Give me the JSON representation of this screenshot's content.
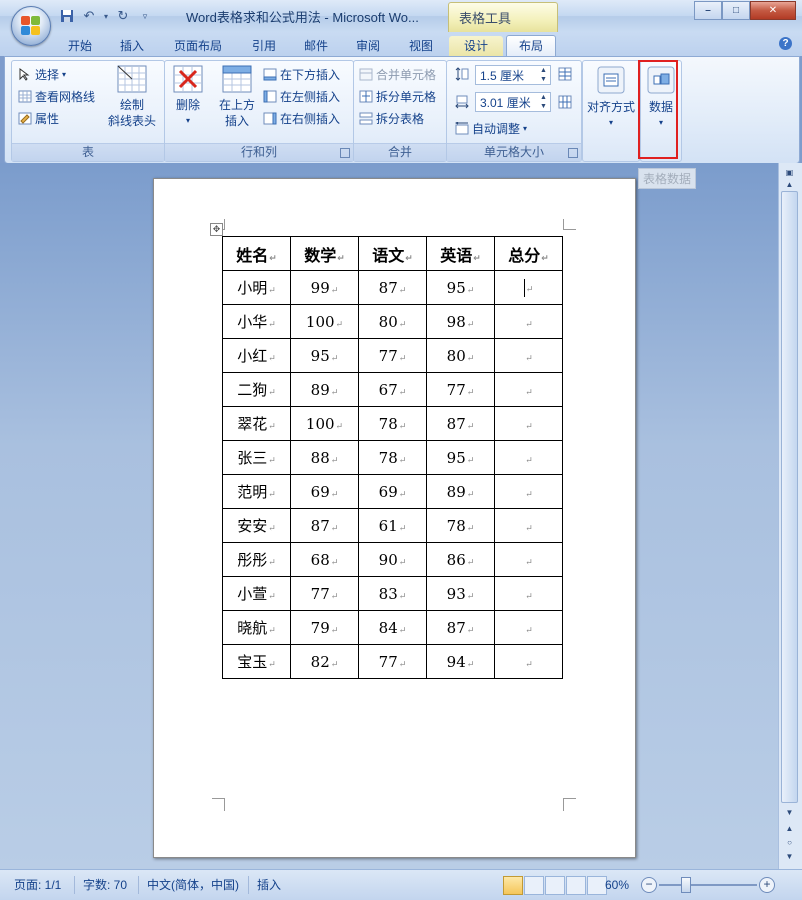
{
  "window": {
    "title": "Word表格求和公式用法 - Microsoft Wo...",
    "context_group": "表格工具",
    "controls": {
      "minimize": "–",
      "maximize": "□",
      "close": "✕"
    }
  },
  "tabs": [
    {
      "label": "开始"
    },
    {
      "label": "插入"
    },
    {
      "label": "页面布局"
    },
    {
      "label": "引用"
    },
    {
      "label": "邮件"
    },
    {
      "label": "审阅"
    },
    {
      "label": "视图"
    },
    {
      "label": "设计"
    },
    {
      "label": "布局"
    }
  ],
  "ribbon": {
    "table_group": {
      "label": "表",
      "select": "选择",
      "gridlines": "查看网格线",
      "properties": "属性",
      "draw_diagonal_line1": "绘制",
      "draw_diagonal_line2": "斜线表头"
    },
    "rows_cols_group": {
      "label": "行和列",
      "delete": "删除",
      "insert_above_line1": "在上方",
      "insert_above_line2": "插入",
      "insert_below": "在下方插入",
      "insert_left": "在左侧插入",
      "insert_right": "在右侧插入"
    },
    "merge_group": {
      "label": "合并",
      "merge_cells": "合并单元格",
      "split_cells": "拆分单元格",
      "split_table": "拆分表格"
    },
    "cell_size_group": {
      "label": "单元格大小",
      "height_value": "1.5 厘米",
      "width_value": "3.01 厘米",
      "autofit": "自动调整"
    },
    "alignment": {
      "label": "对齐方式"
    },
    "data": {
      "label": "数据",
      "tooltip": "表格数据"
    }
  },
  "table": {
    "headers": [
      "姓名",
      "数学",
      "语文",
      "英语",
      "总分"
    ],
    "rows": [
      [
        "小明",
        "99",
        "87",
        "95",
        ""
      ],
      [
        "小华",
        "100",
        "80",
        "98",
        ""
      ],
      [
        "小红",
        "95",
        "77",
        "80",
        ""
      ],
      [
        "二狗",
        "89",
        "67",
        "77",
        ""
      ],
      [
        "翠花",
        "100",
        "78",
        "87",
        ""
      ],
      [
        "张三",
        "88",
        "78",
        "95",
        ""
      ],
      [
        "范明",
        "69",
        "69",
        "89",
        ""
      ],
      [
        "安安",
        "87",
        "61",
        "78",
        ""
      ],
      [
        "彤彤",
        "68",
        "90",
        "86",
        ""
      ],
      [
        "小萱",
        "77",
        "83",
        "93",
        ""
      ],
      [
        "晓航",
        "79",
        "84",
        "87",
        ""
      ],
      [
        "宝玉",
        "82",
        "77",
        "94",
        ""
      ]
    ]
  },
  "status": {
    "page": "页面: 1/1",
    "words": "字数: 70",
    "language": "中文(简体，中国)",
    "mode": "插入",
    "zoom": "60%",
    "zoom_level": 0.6
  }
}
